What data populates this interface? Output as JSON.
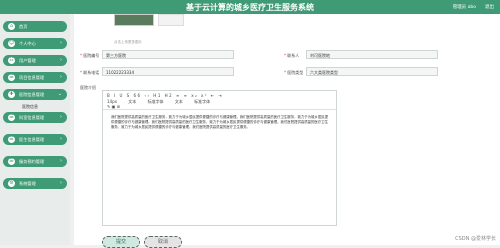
{
  "header": {
    "title": "基于云计算的城乡医疗卫生服务系统",
    "user": "管理员 abo",
    "exit": "退出"
  },
  "sidebar": {
    "items": [
      {
        "label": "首页",
        "icon": "home-icon",
        "glyph": "⌂"
      },
      {
        "label": "个人中心",
        "icon": "user-icon",
        "glyph": "☺"
      },
      {
        "label": "用户管理",
        "icon": "users-icon",
        "glyph": "☷"
      },
      {
        "label": "项目信息管理",
        "icon": "project-icon",
        "glyph": "☰"
      },
      {
        "label": "医院信息管理",
        "icon": "hospital-icon",
        "glyph": "✚"
      }
    ],
    "submenu": "医院信息",
    "items2": [
      {
        "label": "科室信息管理",
        "icon": "department-icon",
        "glyph": "☰"
      },
      {
        "label": "医生信息管理",
        "icon": "doctor-icon",
        "glyph": "☰"
      },
      {
        "label": "服务预约管理",
        "icon": "appointment-icon",
        "glyph": "☰"
      },
      {
        "label": "系统管理",
        "icon": "settings-icon",
        "glyph": "⚙"
      }
    ]
  },
  "form": {
    "upload_hint": "点击上传更多图片",
    "hospital_name_label": "医院编号",
    "hospital_name_value": "第三方医院",
    "contact_label": "联系人",
    "contact_value": "刘可医院地",
    "phone_label": "联系电话",
    "phone_value": "11022223334",
    "type_label": "医院类型",
    "type_value": "六大类医院类型",
    "intro_label": "医院介绍",
    "toolbar": {
      "row1": "B I U S 66 ‹› H1 H2 ≡ ≡ x₂ x² ⇤ ⇥",
      "row2": [
        "14px",
        "文本",
        "标准字体",
        "文本",
        "标准字体"
      ],
      "row3": "✎ ▣ ⊞"
    },
    "intro_text": "我们医院提供高质量的医疗卫生服务，致力于为城乡居民提供便捷的诊疗与健康管理。我们医院提供高质量的医疗卫生服务，致力于为城乡居民提供便捷的诊疗与健康管理。我们医院提供高质量的医疗卫生服务，致力于为城乡居民提供便捷的诊疗与健康管理。我们医院提供高质量的医疗卫生服务，致力于为城乡居民提供便捷的诊疗与健康管理。我们医院提供高质量的医疗卫生服务。",
    "submit": "提交",
    "cancel": "取消"
  },
  "watermark": "CSDN @爱林学长"
}
